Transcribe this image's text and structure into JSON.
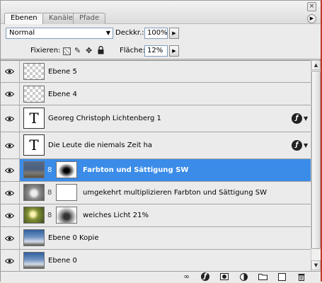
{
  "tabs": [
    {
      "label": "Ebenen",
      "active": true
    },
    {
      "label": "Kanäle",
      "active": false
    },
    {
      "label": "Pfade",
      "active": false
    }
  ],
  "window": {
    "close_glyph": "×",
    "menu_glyph": "▶"
  },
  "options": {
    "blend_mode": "Normal",
    "opacity_label": "Deckkr.:",
    "opacity_value": "100%",
    "lock_label": "Fixieren:",
    "fill_label": "Fläche:",
    "fill_value": "12%"
  },
  "layers": [
    {
      "name": "Ebene 5",
      "thumb": "transparent",
      "visible": true
    },
    {
      "name": "Ebene 4",
      "thumb": "transparent",
      "visible": true
    },
    {
      "name": "Georeg Christoph Lichtenberg 1",
      "thumb": "text",
      "thumb_glyph": "T",
      "fx": true,
      "visible": true
    },
    {
      "name": "Die  Leute die niemals Zeit ha",
      "thumb": "text",
      "thumb_glyph": "T",
      "fx": true,
      "visible": true
    },
    {
      "name": "Farbton und Sättigung SW",
      "thumb": "photo-town",
      "mask": "mask-blur",
      "selected": true,
      "visible": true
    },
    {
      "name": "umgekehrt multiplizieren Farbton und Sättigung SW",
      "thumb": "photo-gray",
      "mask": "white",
      "visible": true
    },
    {
      "name": "weiches Licht 21%",
      "thumb": "photo-palm",
      "mask": "mask-soft",
      "visible": true
    },
    {
      "name": "Ebene 0 Kopie",
      "thumb": "photo-sky",
      "visible": true
    },
    {
      "name": "Ebene 0",
      "thumb": "photo-sky",
      "visible": true
    }
  ],
  "colors": {
    "selection": "#3b8ce8",
    "panel_border": "#c0392b"
  },
  "bottom_icons": [
    "link-icon",
    "fx-icon",
    "mask-icon",
    "adjustment-icon",
    "folder-icon",
    "new-layer-icon",
    "trash-icon"
  ],
  "glyphs": {
    "fx": "ƒ",
    "dropdown": "▼",
    "step": "▶",
    "chain": "8",
    "text_thumb": "T"
  }
}
